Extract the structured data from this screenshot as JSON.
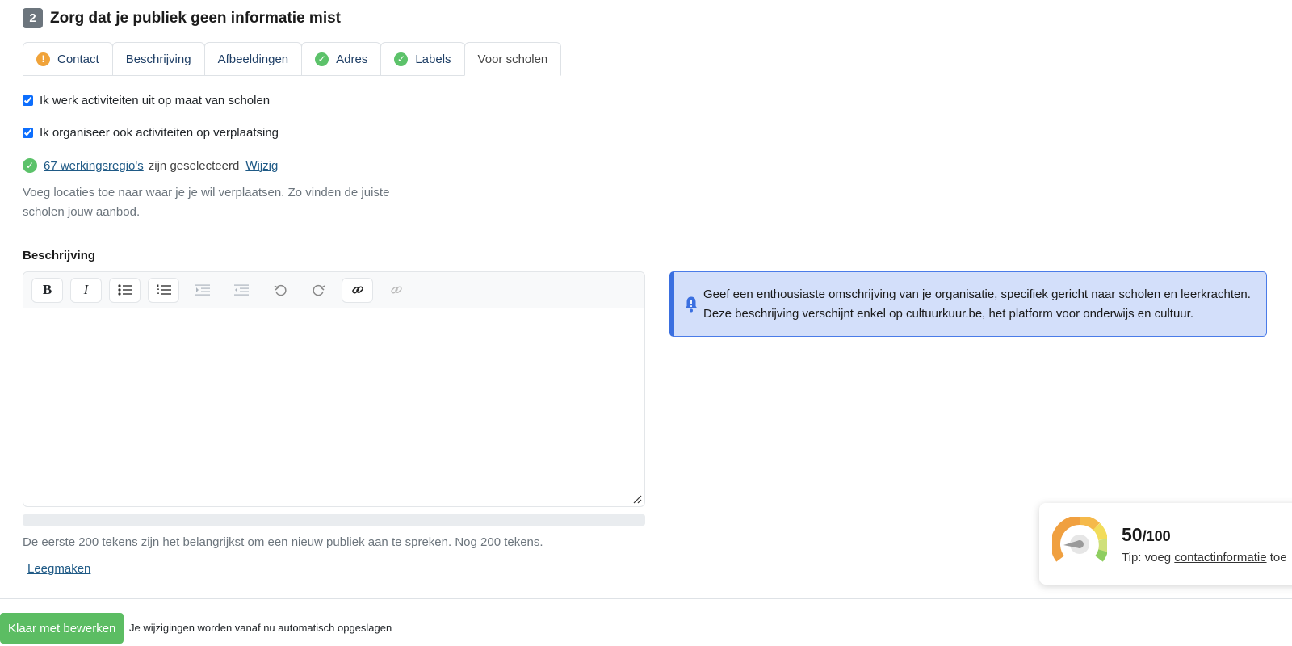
{
  "step": {
    "number": "2",
    "title": "Zorg dat je publiek geen informatie mist"
  },
  "tabs": [
    {
      "label": "Contact",
      "status": "warning",
      "active": false
    },
    {
      "label": "Beschrijving",
      "status": "none",
      "active": false
    },
    {
      "label": "Afbeeldingen",
      "status": "none",
      "active": false
    },
    {
      "label": "Adres",
      "status": "ok",
      "active": false
    },
    {
      "label": "Labels",
      "status": "ok",
      "active": false
    },
    {
      "label": "Voor scholen",
      "status": "none",
      "active": true
    }
  ],
  "checks": {
    "schools": {
      "label": "Ik werk activiteiten uit op maat van scholen",
      "checked": true
    },
    "travel": {
      "label": "Ik organiseer ook activiteiten op verplaatsing",
      "checked": true
    }
  },
  "regions": {
    "link": "67 werkingsregio's",
    "text": "zijn geselecteerd",
    "edit": "Wijzig"
  },
  "help": "Voeg locaties toe naar waar je je wil verplaatsen. Zo vinden de juiste scholen jouw aanbod.",
  "description": {
    "label": "Beschrijving",
    "toolbar": [
      "bold-icon",
      "italic-icon",
      "bullet-list-icon",
      "numbered-list-icon",
      "indent-icon",
      "outdent-icon",
      "undo-icon",
      "redo-icon",
      "link-icon",
      "unlink-icon"
    ],
    "content": "",
    "progress": 0,
    "counter": "De eerste 200 tekens zijn het belangrijkst om een nieuw publiek aan te spreken. Nog 200 tekens.",
    "clear": "Leegmaken"
  },
  "info": {
    "line1": "Geef een enthousiaste omschrijving van je organisatie, specifiek gericht naar scholen en leerkrachten.",
    "line2": "Deze beschrijving verschijnt enkel op cultuurkuur.be, het platform voor onderwijs en cultuur."
  },
  "score": {
    "value": "50",
    "max": "/100",
    "tip_prefix": "Tip: voeg ",
    "tip_link": "contactinformatie",
    "tip_suffix": " toe",
    "level": 0.5
  },
  "footer": {
    "done": "Klaar met bewerken",
    "autosave": "Je wijzigingen worden vanaf nu automatisch opgeslagen"
  },
  "colors": {
    "warning": "#f0a33a",
    "ok": "#5cc26a",
    "info_bg": "#d3dffa",
    "info_border": "#3a6fe0",
    "done_button": "#5cbd63"
  }
}
